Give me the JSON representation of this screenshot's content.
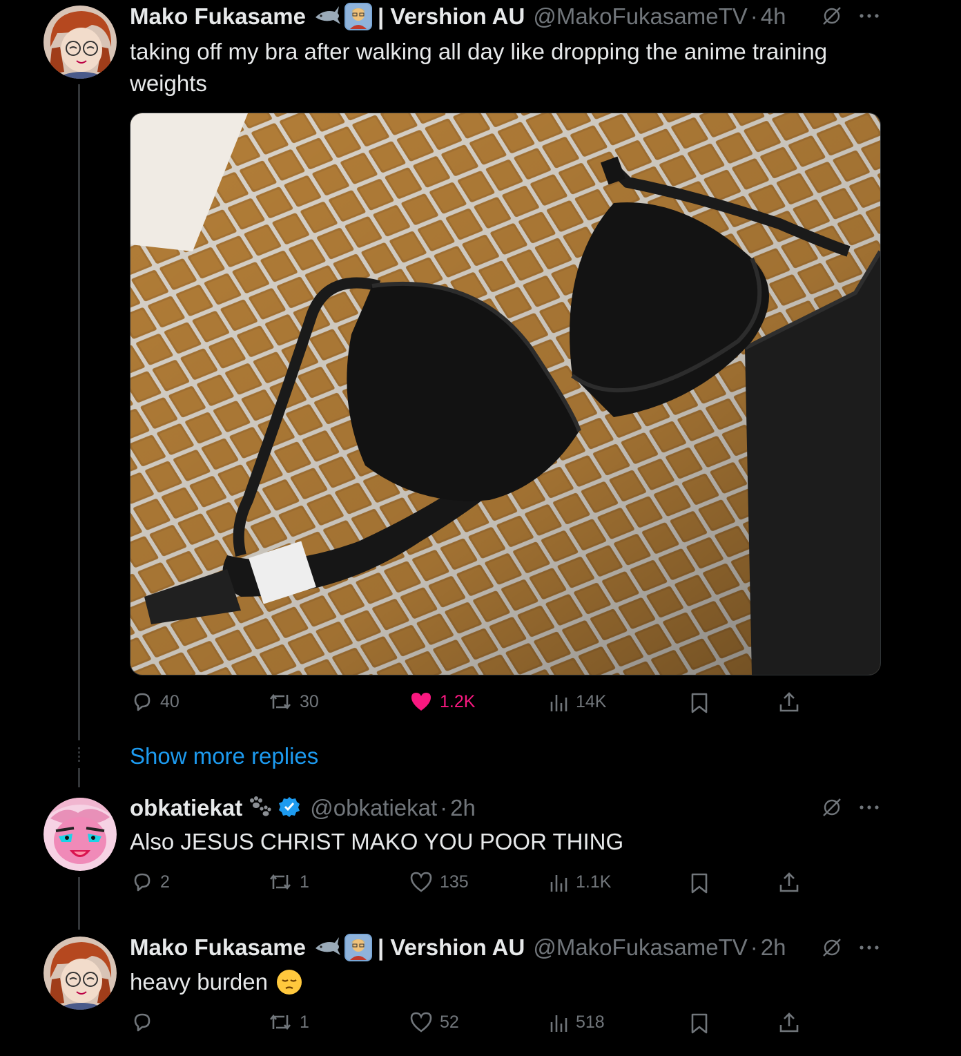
{
  "tweets": [
    {
      "name": "Mako Fukasame",
      "name_suffix": "| Vershion AU",
      "handle": "@MakoFukasameTV",
      "time": "4h",
      "text_line1": "taking off my bra after walking all day like dropping the anime training",
      "text_line2": "weights",
      "actions": {
        "replies": "40",
        "retweets": "30",
        "likes": "1.2K",
        "views": "14K"
      },
      "liked": true
    },
    {
      "name": "obkatiekat",
      "handle": "@obkatiekat",
      "time": "2h",
      "text": "Also JESUS CHRIST MAKO YOU POOR THING",
      "verified": true,
      "actions": {
        "replies": "2",
        "retweets": "1",
        "likes": "135",
        "views": "1.1K"
      }
    },
    {
      "name": "Mako Fukasame",
      "name_suffix": "| Vershion AU",
      "handle": "@MakoFukasameTV",
      "time": "2h",
      "text": "heavy burden",
      "emoji": "😔",
      "actions": {
        "replies": "",
        "retweets": "1",
        "likes": "52",
        "views": "518"
      }
    }
  ],
  "show_more": "Show more replies",
  "separator": "·",
  "icons": [
    "reply-icon",
    "retweet-icon",
    "like-icon",
    "views-icon",
    "bookmark-icon",
    "share-icon",
    "grok-icon",
    "more-icon",
    "verified-icon"
  ],
  "colors": {
    "accent": "#1d9bf0",
    "like": "#f91880",
    "muted": "#71767b",
    "text": "#e7e9ea"
  }
}
